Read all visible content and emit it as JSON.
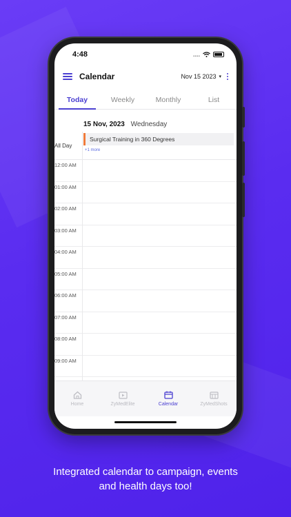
{
  "status_bar": {
    "time": "4:48",
    "dots": "...."
  },
  "app_bar": {
    "title": "Calendar",
    "date_selector": "Nov 15 2023",
    "caret": "▾"
  },
  "tabs": [
    {
      "label": "Today",
      "active": true
    },
    {
      "label": "Weekly",
      "active": false
    },
    {
      "label": "Monthly",
      "active": false
    },
    {
      "label": "List",
      "active": false
    }
  ],
  "day_header": {
    "date": "15 Nov, 2023",
    "weekday": "Wednesday"
  },
  "all_day": {
    "label": "All Day",
    "event_title": "Surgical Training in 360 Degrees",
    "more": "+1 more",
    "event_color": "#f07b3b"
  },
  "hours": [
    "12:00 AM",
    "01:00 AM",
    "02:00 AM",
    "03:00 AM",
    "04:00 AM",
    "05:00 AM",
    "06:00 AM",
    "07:00 AM",
    "08:00 AM",
    "09:00 AM"
  ],
  "bottom_nav": [
    {
      "label": "Home",
      "icon": "home-icon",
      "active": false
    },
    {
      "label": "ZyMedElite",
      "icon": "video-icon",
      "active": false
    },
    {
      "label": "Calendar",
      "icon": "calendar-icon",
      "active": true
    },
    {
      "label": "ZyMedShots",
      "icon": "shots-icon",
      "active": false
    }
  ],
  "caption": {
    "line1": "Integrated calendar to campaign, events",
    "line2": "and health days too!"
  },
  "colors": {
    "accent": "#4a3fd1",
    "background": "#5b2ef2"
  }
}
